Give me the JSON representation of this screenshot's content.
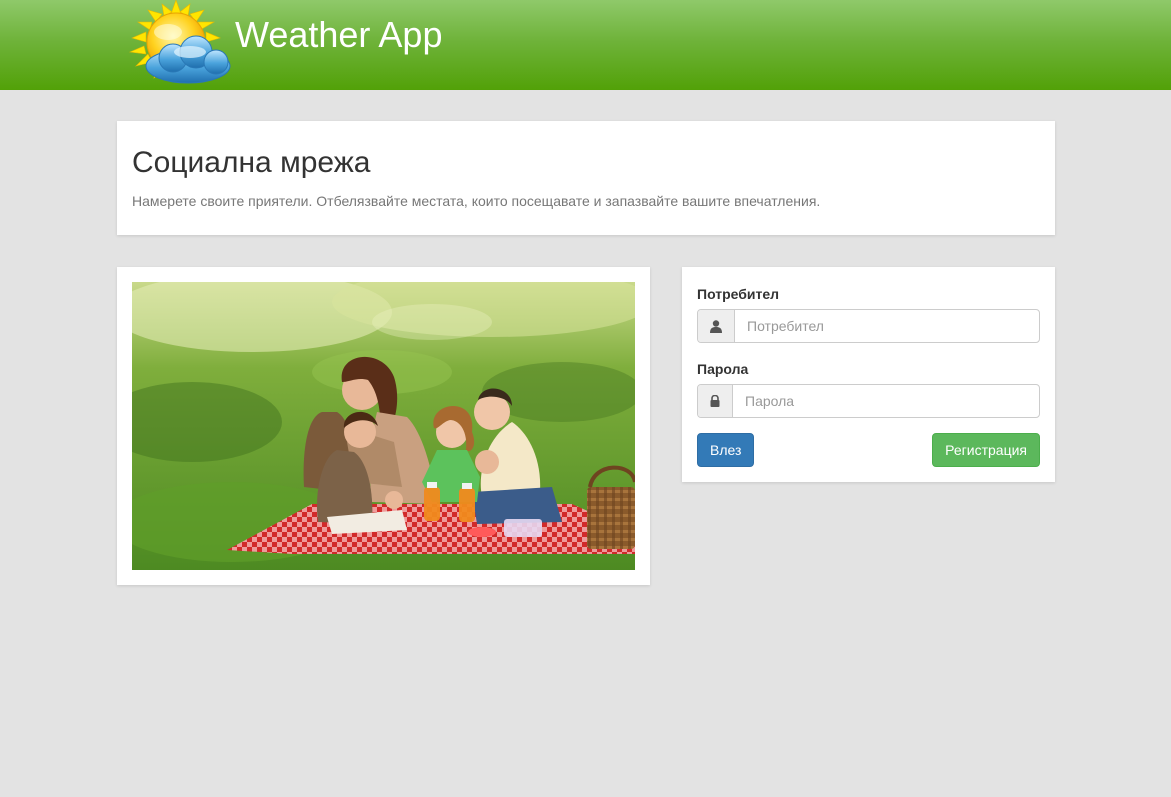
{
  "header": {
    "app_title": "Weather App",
    "logo_icon": "sun-cloud-icon",
    "gradient_top": "#8fc96a",
    "gradient_bottom": "#52a108"
  },
  "intro": {
    "title": "Социална мрежа",
    "description": "Намерете своите приятели. Отбелязвайте местата, които посещавате и запазвайте вашите впечатления."
  },
  "photo": {
    "subject": "family-picnic-photo"
  },
  "login": {
    "username_label": "Потребител",
    "username_placeholder": "Потребител",
    "username_value": "",
    "username_icon": "user-icon",
    "password_label": "Парола",
    "password_placeholder": "Парола",
    "password_value": "",
    "password_icon": "lock-icon",
    "login_button": "Влез",
    "register_button": "Регистрация"
  },
  "colors": {
    "page_background": "#e3e3e3",
    "primary_button": "#337ab7",
    "success_button": "#5cb85c"
  }
}
